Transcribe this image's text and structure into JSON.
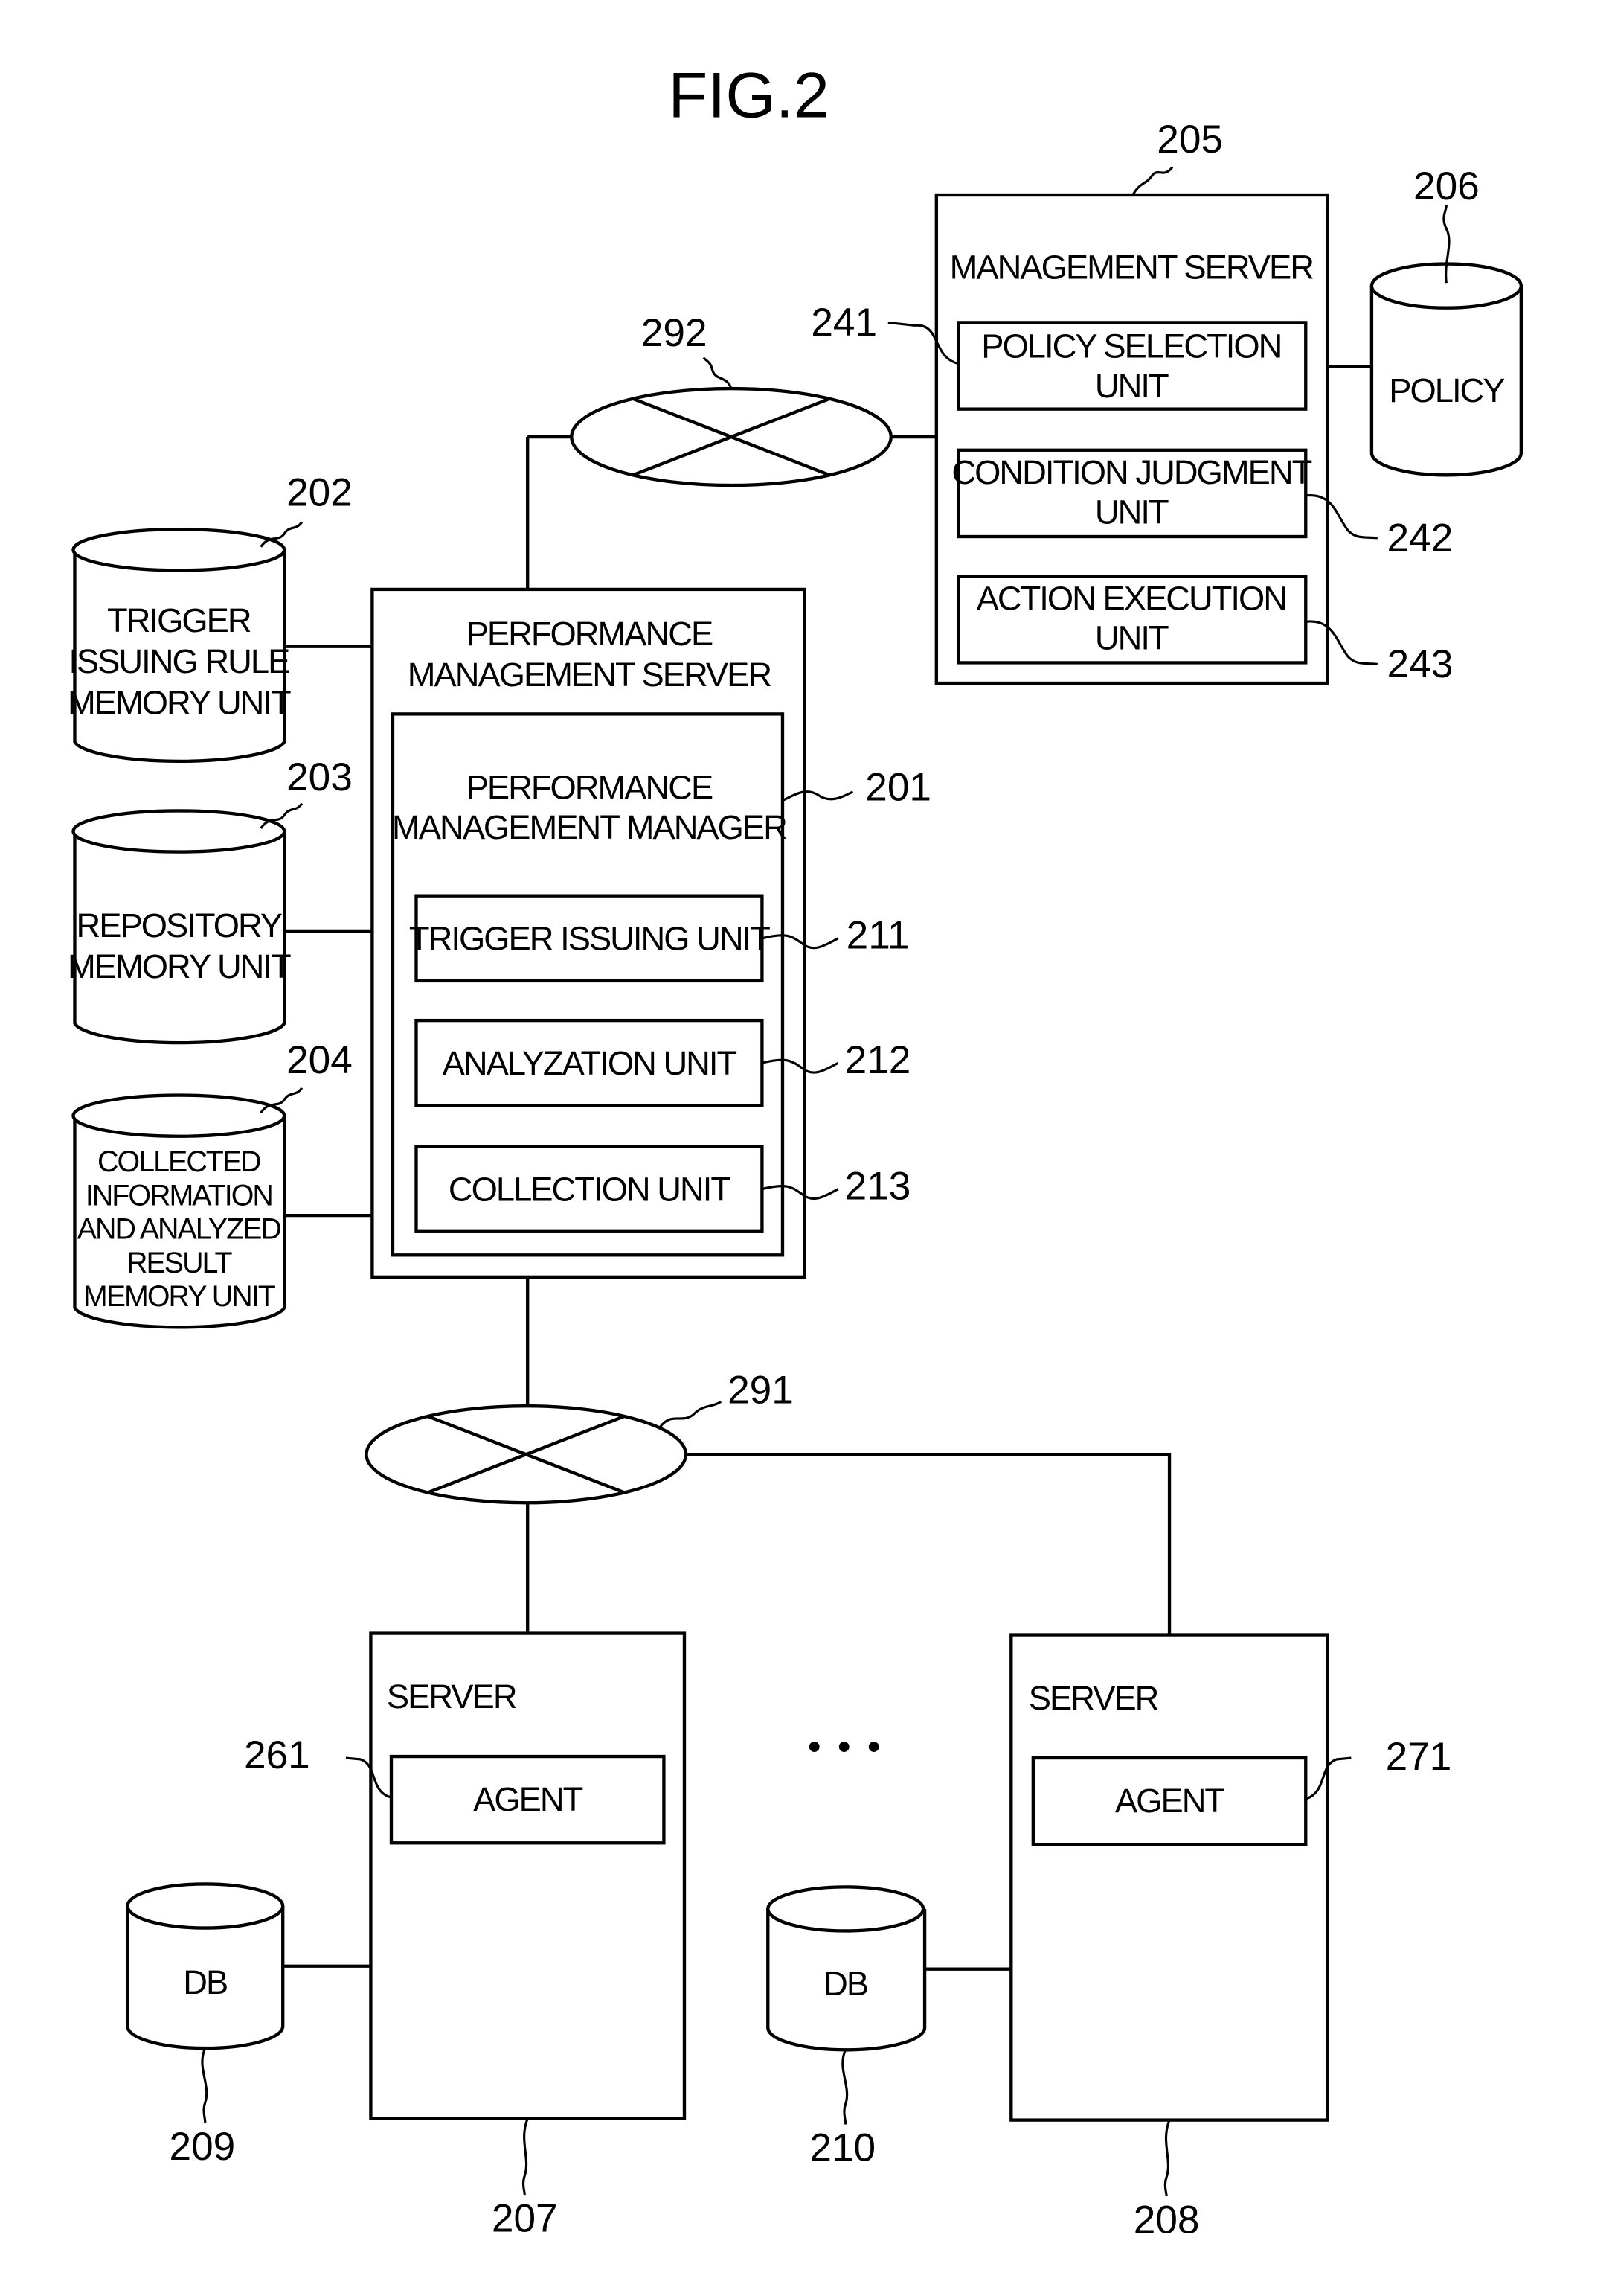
{
  "figure_title": "FIG.2",
  "management_server": {
    "ref": "205",
    "label": "MANAGEMENT SERVER",
    "units": [
      {
        "ref": "241",
        "line1": "POLICY SELECTION",
        "line2": "UNIT"
      },
      {
        "ref": "242",
        "line1": "CONDITION JUDGMENT",
        "line2": "UNIT"
      },
      {
        "ref": "243",
        "line1": "ACTION EXECUTION",
        "line2": "UNIT"
      }
    ]
  },
  "policy_db": {
    "ref": "206",
    "label": "POLICY"
  },
  "network_top": {
    "ref": "292"
  },
  "network_bottom": {
    "ref": "291"
  },
  "memory_units": [
    {
      "ref": "202",
      "lines": [
        "TRIGGER",
        "ISSUING RULE",
        "MEMORY UNIT"
      ]
    },
    {
      "ref": "203",
      "lines": [
        "REPOSITORY",
        "MEMORY UNIT"
      ]
    },
    {
      "ref": "204",
      "lines": [
        "COLLECTED",
        "INFORMATION",
        "AND ANALYZED",
        "RESULT",
        "MEMORY UNIT"
      ]
    }
  ],
  "performance_server": {
    "line1": "PERFORMANCE",
    "line2": "MANAGEMENT SERVER",
    "manager": {
      "ref": "201",
      "line1": "PERFORMANCE",
      "line2": "MANAGEMENT MANAGER",
      "units": [
        {
          "ref": "211",
          "label": "TRIGGER ISSUING UNIT"
        },
        {
          "ref": "212",
          "label": "ANALYZATION UNIT"
        },
        {
          "ref": "213",
          "label": "COLLECTION UNIT"
        }
      ]
    }
  },
  "servers": [
    {
      "ref": "207",
      "label": "SERVER",
      "agent": {
        "ref": "261",
        "label": "AGENT"
      },
      "db": {
        "ref": "209",
        "label": "DB"
      }
    },
    {
      "ref": "208",
      "label": "SERVER",
      "agent": {
        "ref": "271",
        "label": "AGENT"
      },
      "db": {
        "ref": "210",
        "label": "DB"
      }
    }
  ],
  "ellipsis": "• • •"
}
